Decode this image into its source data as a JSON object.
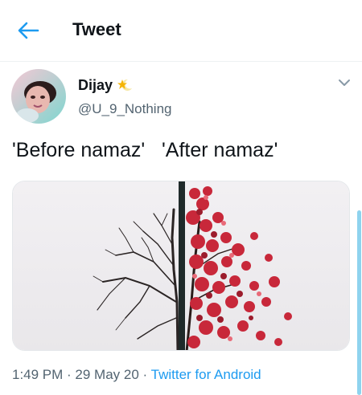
{
  "header": {
    "title": "Tweet",
    "back_icon": "arrow-left-icon",
    "accent": "#1d9bf0"
  },
  "author": {
    "name": "Dijay",
    "handle": "@U_9_Nothing",
    "badge_icon": "star-moon-emoji-icon"
  },
  "tweet": {
    "text": "'Before namaz'   'After namaz'"
  },
  "media": {
    "icon": "tree-before-after-photo"
  },
  "meta": {
    "time": "1:49 PM",
    "separator": " · ",
    "date": "29 May 20",
    "source": "Twitter for Android"
  },
  "colors": {
    "secondary_text": "#536471",
    "link": "#1d9bf0"
  }
}
